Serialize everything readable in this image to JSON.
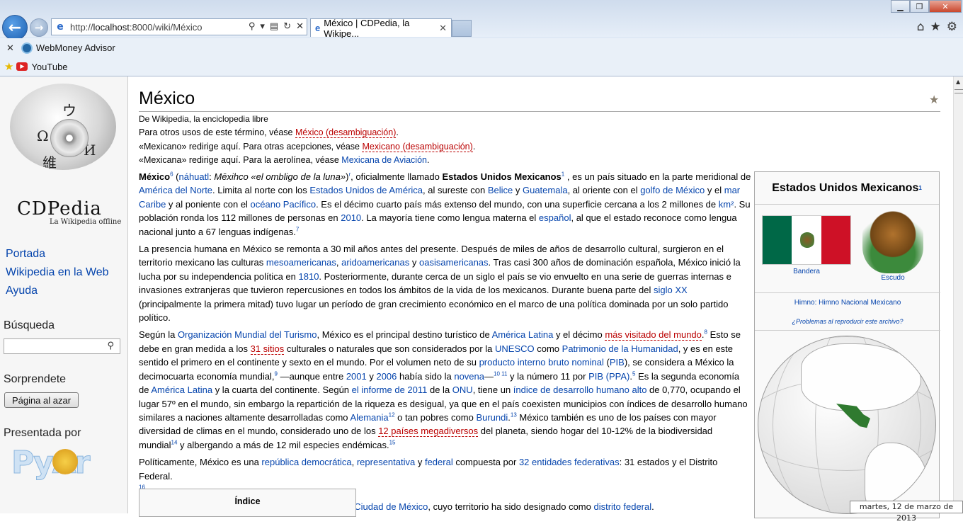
{
  "browser": {
    "address_url_prefix": "http://",
    "address_host": "localhost",
    "address_rest": ":8000/wiki/México",
    "tab_title": "México | CDPedia, la Wikipe...",
    "favorites": [
      {
        "label": "WebMoney Advisor"
      },
      {
        "label": "YouTube"
      }
    ]
  },
  "sidebar": {
    "brand": "CDPedia",
    "brand_sub": "La Wikipedia offline",
    "nav": [
      {
        "label": "Portada"
      },
      {
        "label": "Wikipedia en la Web"
      },
      {
        "label": "Ayuda"
      }
    ],
    "search_heading": "Búsqueda",
    "search_value": "",
    "surprise_heading": "Sorprendete",
    "random_button": "Página al azar",
    "presented_by": "Presentada por",
    "sponsor_logo": "PyAr"
  },
  "article": {
    "title": "México",
    "from": "De Wikipedia, la enciclopedia libre",
    "hatnotes": [
      {
        "pre": "Para otros usos de este término, véase ",
        "link": "México (desambiguación)",
        "post": "."
      },
      {
        "pre": "«Mexicano» redirige aquí. Para otras acepciones, véase ",
        "link": "Mexicano (desambiguación)",
        "post": "."
      },
      {
        "pre": "«Mexicana» redirige aquí. Para la aerolínea, véase ",
        "link": "Mexicana de Aviación",
        "post": "."
      }
    ],
    "toc_title": "Índice"
  },
  "infobox": {
    "title": "Estados Unidos Mexicanos",
    "flag_caption": "Bandera",
    "coat_caption": "Escudo",
    "anthem": "Himno: Himno Nacional Mexicano",
    "problems": "¿Problemas al reproducir este archivo?",
    "colors": {
      "flag_green": "#006847",
      "flag_red": "#ce1126",
      "mexico_on_map": "#2f7a2f"
    }
  },
  "taskbar": {
    "clock": "martes, 12 de marzo de 2013"
  }
}
